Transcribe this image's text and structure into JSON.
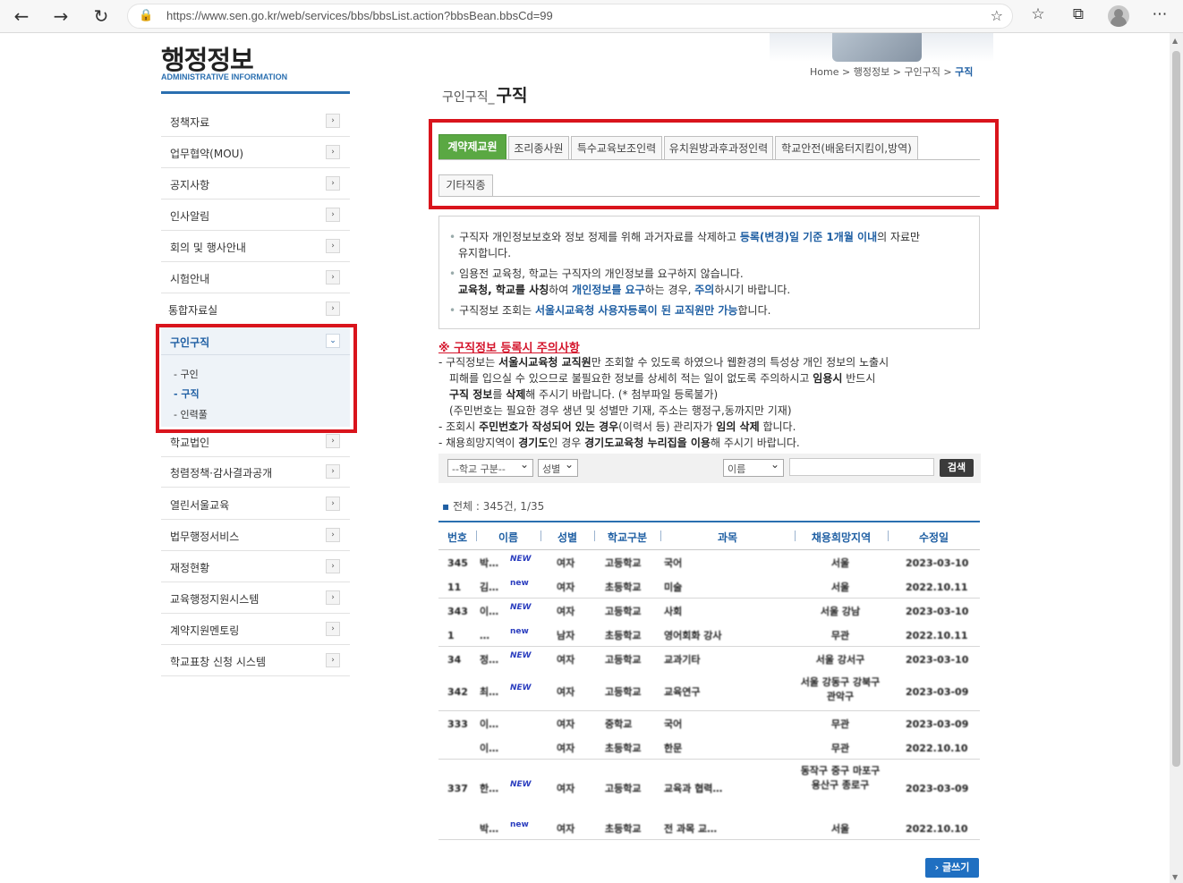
{
  "browser": {
    "url": "https://www.sen.go.kr/web/services/bbs/bbsList.action?bbsBean.bbsCd=99",
    "back": "←",
    "forward": "→",
    "reload": "↻",
    "lock": "🔒",
    "fav_add": "☆",
    "favorites": "☆",
    "collections": "⧉",
    "menu": "⋯"
  },
  "brand": {
    "title": "행정정보",
    "subtitle": "ADMINISTRATIVE INFORMATION"
  },
  "sidebar": {
    "items": [
      {
        "label": "정책자료"
      },
      {
        "label": "업무협약(MOU)"
      },
      {
        "label": "공지사항"
      },
      {
        "label": "인사알림"
      },
      {
        "label": "회의 및 행사안내"
      },
      {
        "label": "시험안내"
      },
      {
        "label": "통합자료실"
      }
    ],
    "open": {
      "label": "구인구직",
      "subs": [
        {
          "label": "- 구인"
        },
        {
          "label": "- 구직"
        },
        {
          "label": "- 인력풀"
        }
      ]
    },
    "items_after": [
      {
        "label": "학교법인"
      },
      {
        "label": "청렴정책·감사결과공개"
      },
      {
        "label": "열린서울교육"
      },
      {
        "label": "법무행정서비스"
      },
      {
        "label": "재정현황"
      },
      {
        "label": "교육행정지원시스템"
      },
      {
        "label": "계약지원멘토링"
      },
      {
        "label": "학교표창 신청 시스템"
      }
    ],
    "arrow": "›",
    "arrow_open": "⌄"
  },
  "breadcrumb": {
    "home": "Home",
    "sep": ">",
    "level1": "행정정보",
    "level2": "구인구직",
    "current": "구직"
  },
  "page_title": {
    "prefix": "구인구직_",
    "title": "구직"
  },
  "tabs": {
    "row1": [
      {
        "label": "계약제교원",
        "active": true
      },
      {
        "label": "조리종사원"
      },
      {
        "label": "특수교육보조인력"
      },
      {
        "label": "유치원방과후과정인력"
      },
      {
        "label": "학교안전(배움터지킴이,방역)"
      }
    ],
    "row2": [
      {
        "label": "기타직종"
      }
    ]
  },
  "notice": {
    "line1_a": "구직자 개인정보보호와 정보 정제를 위해 과거자료를 삭제하고 ",
    "line1_hl": "등록(변경)일 기준 1개월 이내",
    "line1_b": "의 자료만",
    "line1_c": "유지합니다.",
    "line2": "임용전 교육청, 학교는 구직자의 개인정보를 요구하지 않습니다.",
    "line3_a": "교육청, 학교를 사칭",
    "line3_b": "하여 ",
    "line3_hl1": "개인정보를 요구",
    "line3_c": "하는 경우, ",
    "line3_hl2": "주의",
    "line3_d": "하시기 바랍니다.",
    "line4_a": "구직정보 조회는 ",
    "line4_hl": "서울시교육청 사용자등록이 된 교직원만 가능",
    "line4_b": "합니다."
  },
  "caution": {
    "title": "※ 구직정보 등록시 주의사항",
    "l1_a": "- 구직정보는 ",
    "l1_b": "서울시교육청 교직원",
    "l1_c": "만 조회할 수 있도록 하였으나 웹환경의 특성상 개인 정보의 노출시",
    "l2_a": "  피해를 입으실 수 있으므로 불필요한 정보를 상세히 적는 일이 없도록 주의하시고 ",
    "l2_b": "임용시",
    "l2_c": " 반드시",
    "l3_a": "  구직 정보",
    "l3_b": "를 ",
    "l3_c": "삭제",
    "l3_d": "해 주시기 바랍니다. (* 첨부파일 등록불가)",
    "l4": "  (주민번호는 필요한 경우 생년 및 성별만 기재, 주소는 행정구,동까지만 기재)",
    "l5_a": "- 조회시 ",
    "l5_b": "주민번호가 작성되어 있는 경우",
    "l5_c": "(이력서 등) 관리자가 ",
    "l5_d": "임의 삭제",
    "l5_e": " 합니다.",
    "l6_a": "- 채용희망지역이 ",
    "l6_b": "경기도",
    "l6_c": "인 경우 ",
    "l6_d": "경기도교육청 누리집을 이용",
    "l6_e": "해 주시기 바랍니다."
  },
  "search": {
    "school_select": "--학교 구분--",
    "gender_select": "성별",
    "field_select": "이름",
    "input_value": "",
    "button": "검색"
  },
  "total": {
    "label": "전체 :",
    "value": "345건, 1/35"
  },
  "table": {
    "headers": [
      "번호",
      "이름",
      "성별",
      "학교구분",
      "과목",
      "채용희망지역",
      "수정일"
    ],
    "rows": [
      {
        "no": "345",
        "name": "박…",
        "tag": "NEW",
        "gender": "여자",
        "school": "고등학교",
        "subject": "국어",
        "region": "서울",
        "date": "2023-03-10"
      },
      {
        "no": "11",
        "name": "김…",
        "tag": "new",
        "gender": "여자",
        "school": "초등학교",
        "subject": "미술",
        "region": "서울",
        "date": "2022.10.11"
      },
      {
        "no": "343",
        "name": "이…",
        "tag": "NEW",
        "gender": "여자",
        "school": "고등학교",
        "subject": "사회",
        "region": "서울 강남",
        "date": "2023-03-10"
      },
      {
        "no": "1",
        "name": "…",
        "tag": "new",
        "gender": "남자",
        "school": "초등학교",
        "subject": "영어회화 강사",
        "region": "무관",
        "date": "2022.10.11"
      },
      {
        "no": "34",
        "name": "정…",
        "tag": "NEW",
        "gender": "여자",
        "school": "고등학교",
        "subject": "교과기타",
        "region": "서울 강서구",
        "date": "2023-03-10"
      },
      {
        "no": "342",
        "name": "최…",
        "tag": "NEW",
        "gender": "여자",
        "school": "고등학교",
        "subject": "교육연구",
        "region": "서울 강동구 강북구 관악구",
        "date": "2023-03-09"
      },
      {
        "no": "333",
        "name": "이…",
        "tag": "",
        "gender": "여자",
        "school": "중학교",
        "subject": "국어",
        "region": "무관",
        "date": "2023-03-09"
      },
      {
        "no": "",
        "name": "이…",
        "tag": "",
        "gender": "여자",
        "school": "초등학교",
        "subject": "한문",
        "region": "무관",
        "date": "2022.10.10"
      },
      {
        "no": "337",
        "name": "한…",
        "tag": "NEW",
        "gender": "여자",
        "school": "고등학교",
        "subject": "교육과 협력…",
        "region": "동작구 중구 마포구 용산구 종로구",
        "date": "2023-03-09"
      },
      {
        "no": "",
        "name": "박…",
        "tag": "new",
        "gender": "여자",
        "school": "초등학교",
        "subject": "전 과목 교…",
        "region": "서울",
        "date": "2022.10.10"
      }
    ]
  },
  "write_button": "› 글쓰기",
  "colors": {
    "accent": "#1f5fa3",
    "tab_active": "#5aa843",
    "highlight_box": "#d9141c",
    "caution": "#d4142b"
  }
}
